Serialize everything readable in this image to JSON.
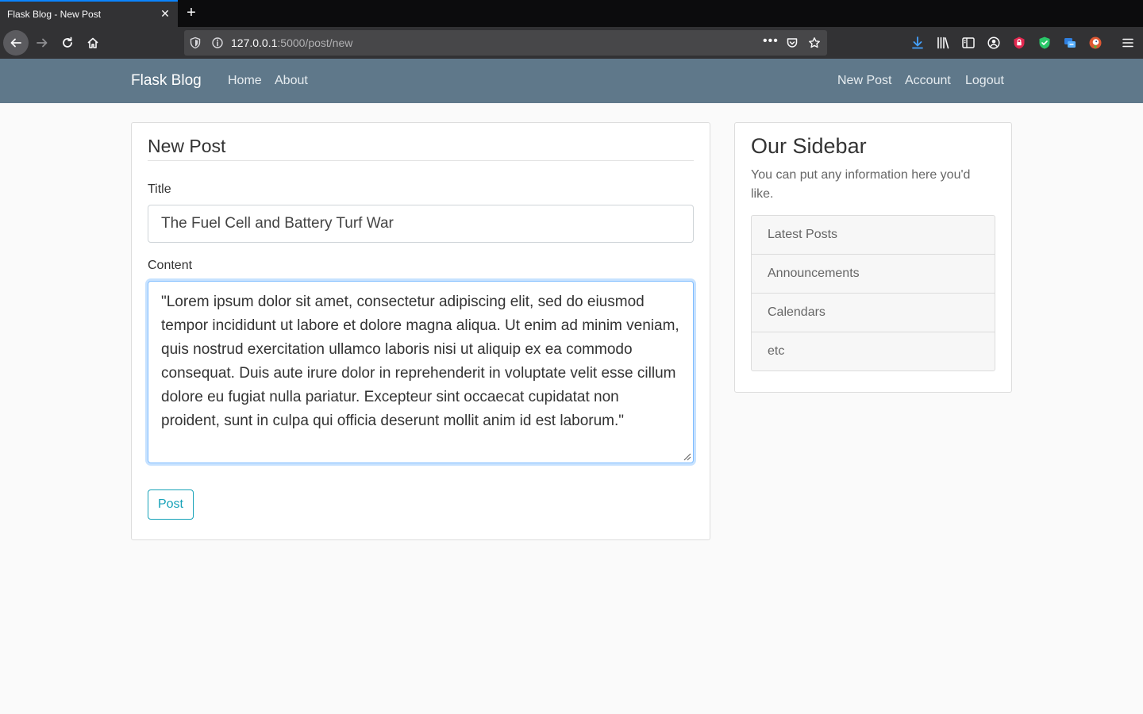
{
  "browser": {
    "tab_title": "Flask Blog - New Post",
    "tab_close": "✕",
    "new_tab": "+",
    "url_host": "127.0.0.1",
    "url_rest": ":5000/post/new",
    "page_actions": "•••"
  },
  "site": {
    "brand": "Flask Blog",
    "nav_left": [
      "Home",
      "About"
    ],
    "nav_right": [
      "New Post",
      "Account",
      "Logout"
    ]
  },
  "form": {
    "legend": "New Post",
    "title_label": "Title",
    "title_value": "The Fuel Cell and Battery Turf War",
    "content_label": "Content",
    "content_value": "\"Lorem ipsum dolor sit amet, consectetur adipiscing elit, sed do eiusmod tempor incididunt ut labore et dolore magna aliqua. Ut enim ad minim veniam, quis nostrud exercitation ullamco laboris nisi ut aliquip ex ea commodo consequat. Duis aute irure dolor in reprehenderit in voluptate velit esse cillum dolore eu fugiat nulla pariatur. Excepteur sint occaecat cupidatat non proident, sunt in culpa qui officia deserunt mollit anim id est laborum.\"",
    "submit_label": "Post"
  },
  "sidebar": {
    "title": "Our Sidebar",
    "text": "You can put any information here you'd like.",
    "items": [
      "Latest Posts",
      "Announcements",
      "Calendars",
      "etc"
    ]
  },
  "colors": {
    "navbar": "#5f788a",
    "accent": "#17a2b8",
    "focus": "#80bdff"
  }
}
